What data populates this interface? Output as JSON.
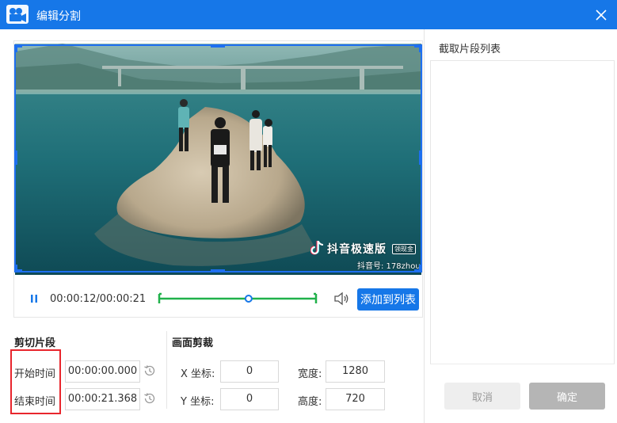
{
  "window": {
    "title": "编辑分割",
    "brand_color": "#1677e8"
  },
  "video": {
    "watermark_app": "抖音极速版",
    "watermark_badge": "领现金",
    "watermark_id": "抖音号: 178zhou",
    "current_time": "00:00:12",
    "total_time": "00:00:21",
    "time_display": "00:00:12/00:00:21",
    "playback_progress_fraction": 0.57,
    "trim_start_fraction": 0.0,
    "trim_end_fraction": 1.0
  },
  "controls": {
    "pause_icon": "pause-icon",
    "volume_icon": "volume-icon",
    "add_to_list_label": "添加到列表"
  },
  "clip_list": {
    "title": "截取片段列表",
    "items": []
  },
  "cut_segment": {
    "title": "剪切片段",
    "start_label": "开始时间",
    "start_value": "00:00:00.000",
    "end_label": "结束时间",
    "end_value": "00:00:21.368",
    "reset_icon": "clock-reset-icon"
  },
  "crop": {
    "title": "画面剪裁",
    "x_label": "X 坐标:",
    "x_value": "0",
    "y_label": "Y 坐标:",
    "y_value": "0",
    "width_label": "宽度:",
    "width_value": "1280",
    "height_label": "高度:",
    "height_value": "720"
  },
  "footer": {
    "cancel_label": "取消",
    "ok_label": "确定"
  },
  "highlight_color": "#e8262d"
}
